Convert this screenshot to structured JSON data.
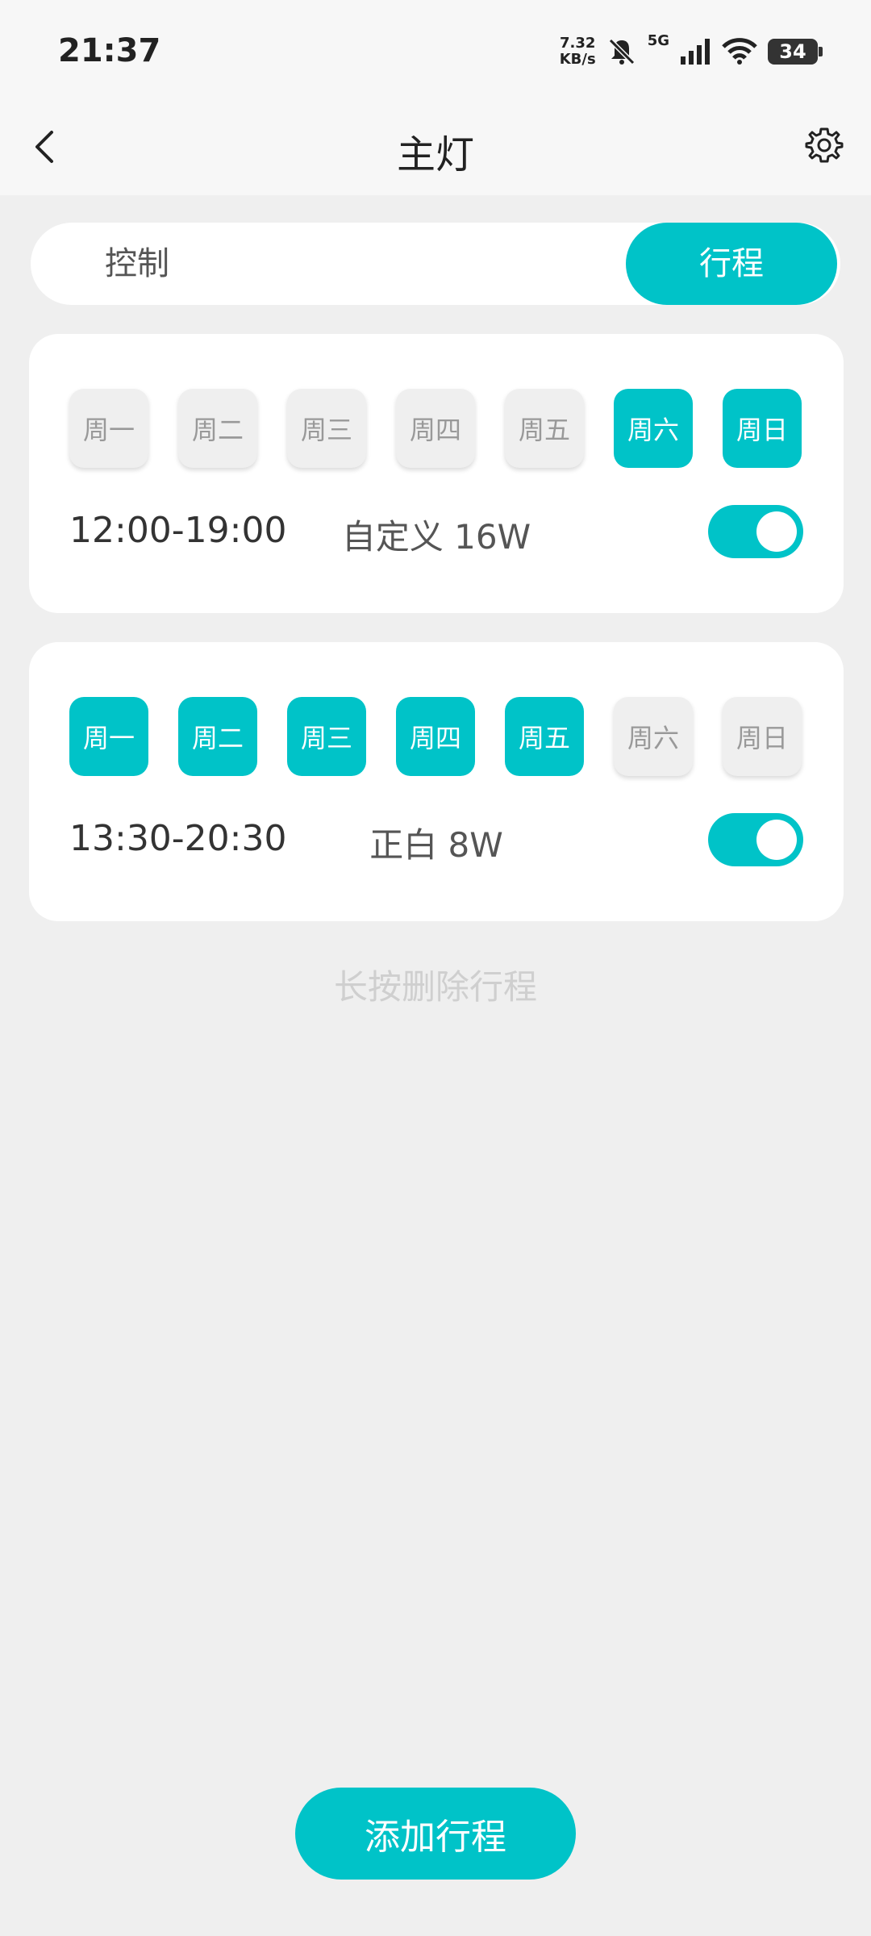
{
  "status_bar": {
    "time": "21:37",
    "net_speed_value": "7.32",
    "net_speed_unit": "KB/s",
    "network_type": "5G",
    "battery": "34"
  },
  "header": {
    "title": "主灯",
    "back_icon": "chevron-left-icon",
    "settings_icon": "gear-icon"
  },
  "tabs": {
    "control": "控制",
    "schedule": "行程",
    "active": "schedule"
  },
  "schedules": [
    {
      "days": [
        {
          "label": "周一",
          "active": false
        },
        {
          "label": "周二",
          "active": false
        },
        {
          "label": "周三",
          "active": false
        },
        {
          "label": "周四",
          "active": false
        },
        {
          "label": "周五",
          "active": false
        },
        {
          "label": "周六",
          "active": true
        },
        {
          "label": "周日",
          "active": true
        }
      ],
      "time": "12:00-19:00",
      "mode": "自定义 16W",
      "enabled": true
    },
    {
      "days": [
        {
          "label": "周一",
          "active": true
        },
        {
          "label": "周二",
          "active": true
        },
        {
          "label": "周三",
          "active": true
        },
        {
          "label": "周四",
          "active": true
        },
        {
          "label": "周五",
          "active": true
        },
        {
          "label": "周六",
          "active": false
        },
        {
          "label": "周日",
          "active": false
        }
      ],
      "time": "13:30-20:30",
      "mode": "正白 8W",
      "enabled": true
    }
  ],
  "hint": "长按删除行程",
  "add_button": "添加行程",
  "colors": {
    "accent": "#00c3c8",
    "background": "#efefef",
    "inactive_day": "#efefef"
  }
}
